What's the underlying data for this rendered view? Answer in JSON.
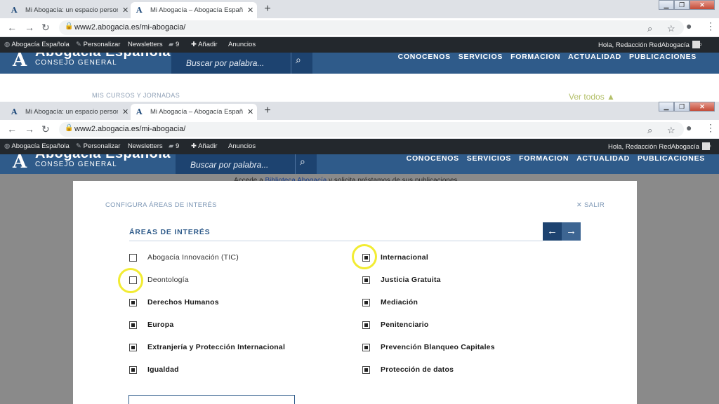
{
  "browser": {
    "tabs": [
      {
        "title": "Mi Abogacía: un espacio persona",
        "favicon": "A",
        "close": "✕"
      },
      {
        "title": "Mi Abogacía – Abogacía Españo",
        "favicon": "A",
        "close": "✕"
      }
    ],
    "new_tab": "+",
    "window_buttons": {
      "minimize": "▁",
      "restore": "❐",
      "close": "✕"
    },
    "url": "www2.abogacia.es/mi-abogacia/"
  },
  "adminbar": {
    "site": "Abogacía Española",
    "customize": "Personalizar",
    "newsletters": "Newsletters",
    "comments_count": "9",
    "add": "Añadir",
    "ads": "Anuncios",
    "greeting": "Hola, Redacción RedAbogacía"
  },
  "site_header": {
    "logo_name": "Abogacía Española",
    "logo_sub": "CONSEJO GENERAL",
    "search_placeholder": "Buscar por palabra...",
    "nav": [
      "CONOCENOS",
      "SERVICIOS",
      "FORMACION",
      "ACTUALIDAD",
      "PUBLICACIONES"
    ]
  },
  "page": {
    "section_label": "MIS CURSOS Y JORNADAS",
    "see_all": "Ver todos ▲",
    "behind_prefix": "Accede a ",
    "behind_link": "Biblioteca Abogacía",
    "behind_suffix": " y solicita préstamos de sus publicaciones"
  },
  "modal": {
    "header": "CONFIGURA ÁREAS DE INTERÉS",
    "close": "✕ SALIR",
    "title": "ÁREAS DE INTERÉS",
    "prev": "←",
    "next": "→",
    "left_column": [
      {
        "label": "Abogacía Innovación (TIC)",
        "checked": false
      },
      {
        "label": "Deontología",
        "checked": false
      },
      {
        "label": "Derechos Humanos",
        "checked": true
      },
      {
        "label": "Europa",
        "checked": true
      },
      {
        "label": "Extranjería y Protección Internacional",
        "checked": true
      },
      {
        "label": "Igualdad",
        "checked": true
      }
    ],
    "right_column": [
      {
        "label": "Internacional",
        "checked": true
      },
      {
        "label": "Justicia Gratuita",
        "checked": true
      },
      {
        "label": "Mediación",
        "checked": true
      },
      {
        "label": "Penitenciario",
        "checked": true
      },
      {
        "label": "Prevención Blanqueo Capitales",
        "checked": true
      },
      {
        "label": "Protección de datos",
        "checked": true
      }
    ]
  },
  "colors": {
    "brand_blue": "#2f5b8a",
    "highlight": "#f2ec33"
  }
}
